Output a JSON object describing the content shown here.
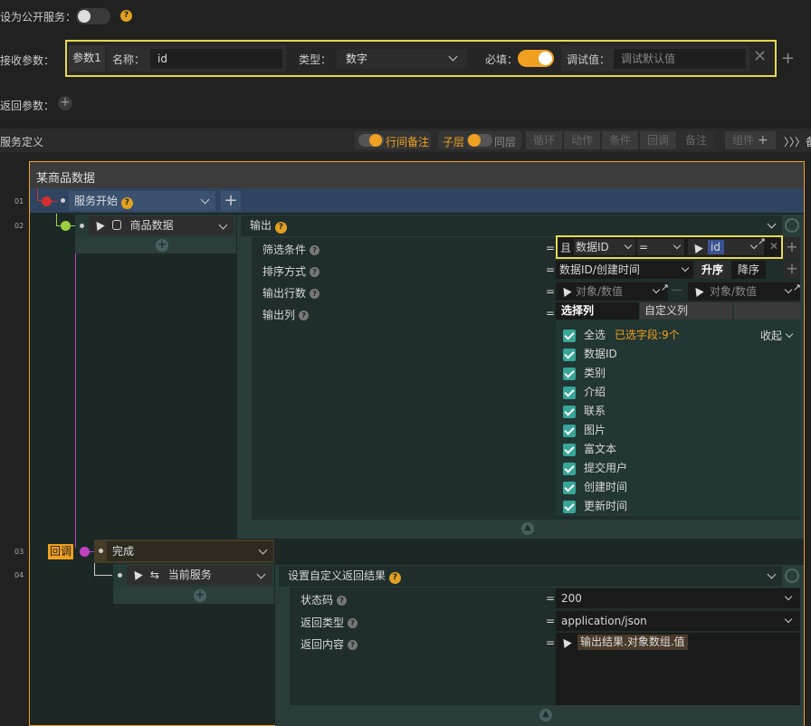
{
  "public_service": {
    "label": "设为公开服务："
  },
  "receive": {
    "label": "接收参数：",
    "param": "参数1",
    "name_label": "名称：",
    "name_value": "id",
    "type_label": "类型：",
    "type_value": "数字",
    "required_label": "必填：",
    "debug_label": "调试值：",
    "debug_placeholder": "调试默认值"
  },
  "return_params": {
    "label": "返回参数："
  },
  "service_def": {
    "label": "服务定义",
    "toggle1": "行间备注",
    "toggle2_left": "子层",
    "toggle2_right": "同层",
    "tools": [
      "循环",
      "动作",
      "条件",
      "回调",
      "备注"
    ],
    "component": "组件",
    "more": "〉〉〉备"
  },
  "flow": {
    "title": "某商品数据",
    "rows": [
      {
        "num": "01"
      },
      {
        "num": "02"
      },
      {
        "num": "03"
      },
      {
        "num": "04"
      }
    ],
    "start": "服务开始",
    "data_node": "商品数据",
    "done_tag": "回调",
    "done": "完成",
    "current_service": "当前服务"
  },
  "output": {
    "title": "输出",
    "filter_label": "筛选条件",
    "filter_and": "且",
    "filter_field": "数据ID",
    "filter_op": "=",
    "filter_value": "id",
    "sort_label": "排序方式",
    "sort_field": "数据ID/创建时间",
    "sort_asc": "升序",
    "sort_desc": "降序",
    "rows_label": "输出行数",
    "rows_ph1": "对象/数值",
    "rows_ph2": "对象/数值",
    "cols_label": "输出列",
    "tab_select": "选择列",
    "tab_custom": "自定义列",
    "select_all": "全选",
    "selected_count": "已选字段:9个",
    "collapse": "收起",
    "fields": [
      "数据ID",
      "类别",
      "介绍",
      "联系",
      "图片",
      "富文本",
      "提交用户",
      "创建时间",
      "更新时间"
    ]
  },
  "result": {
    "title": "设置自定义返回结果",
    "status_label": "状态码",
    "status_value": "200",
    "type_label": "返回类型",
    "type_value": "application/json",
    "content_label": "返回内容",
    "content_value": "输出结果.对象数组.值"
  },
  "colors": {
    "accent": "#f0a020",
    "teal": "#38a59a",
    "highlight": "#e8d84a"
  }
}
